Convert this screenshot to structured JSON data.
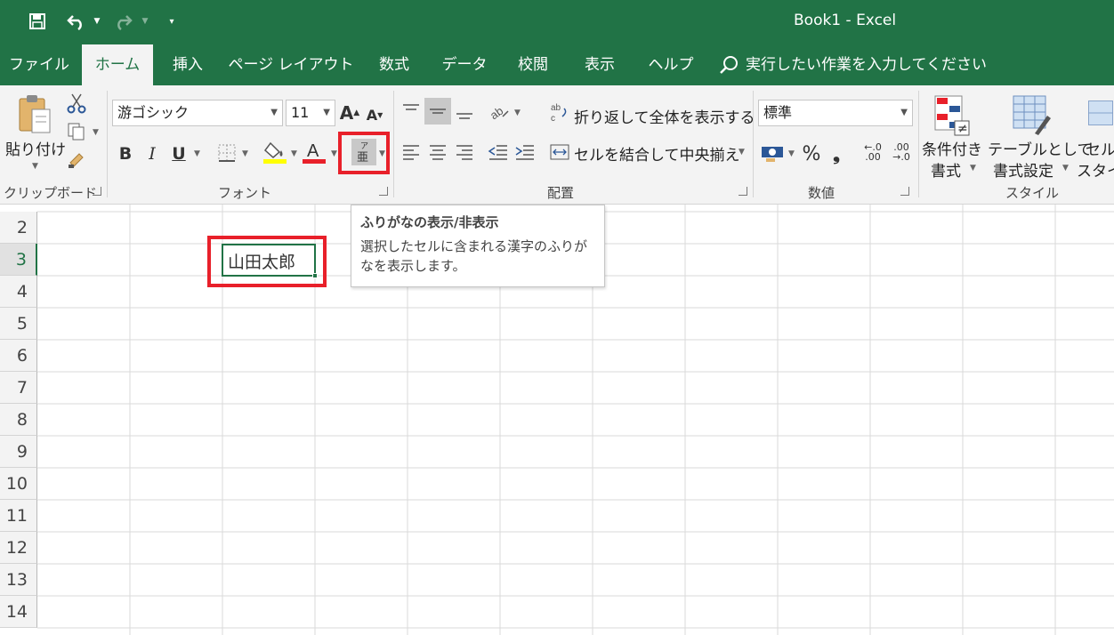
{
  "app": {
    "title": "Book1  -  Excel"
  },
  "tabs": [
    {
      "label": "ファイル",
      "active": false
    },
    {
      "label": "ホーム",
      "active": true
    },
    {
      "label": "挿入",
      "active": false
    },
    {
      "label": "ページ レイアウト",
      "active": false
    },
    {
      "label": "数式",
      "active": false
    },
    {
      "label": "データ",
      "active": false
    },
    {
      "label": "校閲",
      "active": false
    },
    {
      "label": "表示",
      "active": false
    },
    {
      "label": "ヘルプ",
      "active": false
    }
  ],
  "tellme": "実行したい作業を入力してください",
  "ribbon": {
    "clipboard": {
      "paste_label": "貼り付け",
      "group_label": "クリップボード"
    },
    "font": {
      "font_name": "游ゴシック",
      "font_size": "11",
      "group_label": "フォント",
      "bold": "B",
      "italic": "I",
      "underline": "U"
    },
    "alignment": {
      "wrap_text": "折り返して全体を表示する",
      "merge_center": "セルを結合して中央揃え",
      "group_label": "配置"
    },
    "number": {
      "format": "標準",
      "percent": "%",
      "comma": "❟",
      "inc_dec": ".00",
      "dec_dec": ".0",
      "group_label": "数値"
    },
    "styles": {
      "cond_format_1": "条件付き",
      "cond_format_2": "書式",
      "table_format_1": "テーブルとして",
      "table_format_2": "書式設定",
      "cell_styles_1": "セル",
      "cell_styles_2": "スタイル",
      "group_label": "スタイル"
    }
  },
  "tooltip": {
    "title": "ふりがなの表示/非表示",
    "body": "選択したセルに含まれる漢字のふりがなを表示します。"
  },
  "sheet": {
    "rows": [
      "2",
      "3",
      "4",
      "5",
      "6",
      "7",
      "8",
      "9",
      "10",
      "11",
      "12",
      "13",
      "14"
    ],
    "active_cell_value": "山田太郎"
  },
  "colors": {
    "accent": "#217346",
    "highlight": "#e8202a"
  }
}
